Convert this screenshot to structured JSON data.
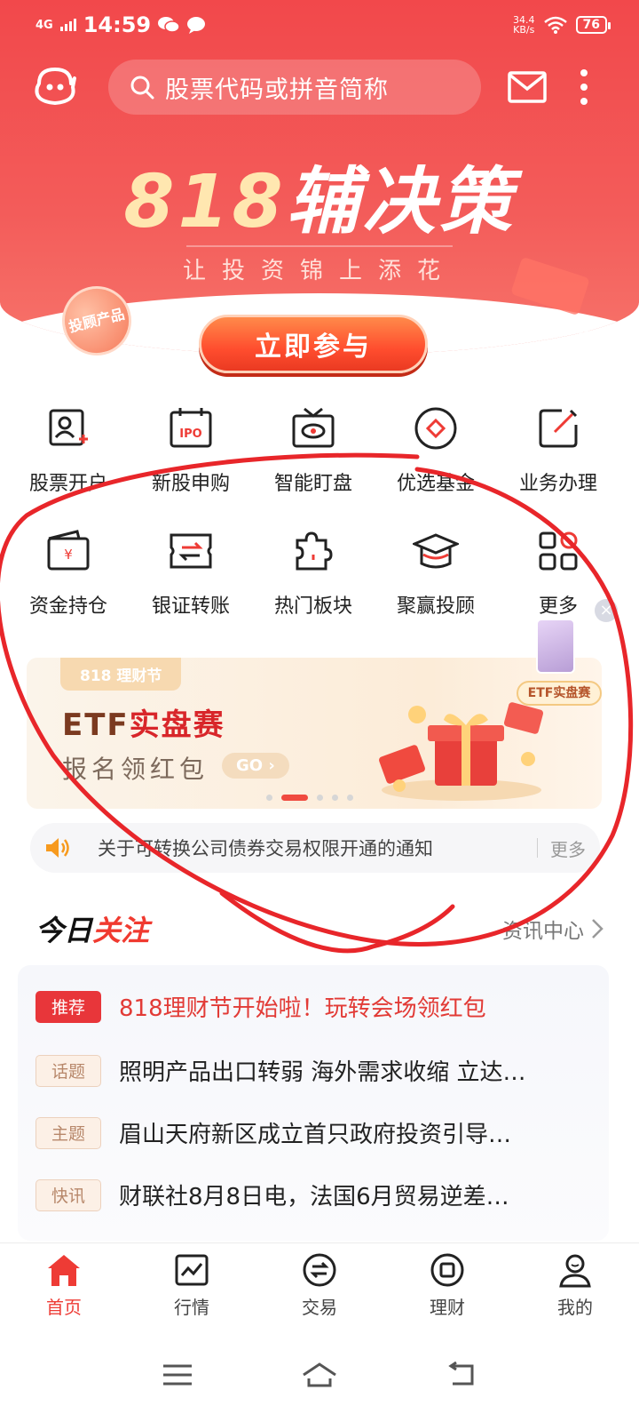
{
  "status_bar": {
    "network": "4G",
    "time": "14:59",
    "speed_value": "34.4",
    "speed_unit": "KB/s",
    "battery": "76"
  },
  "header": {
    "search_placeholder": "股票代码或拼音简称"
  },
  "hero_banner": {
    "title_num": "818",
    "title_text": "辅决策",
    "subtitle": "让投资锦上添花",
    "badge": "投顾产品",
    "cta": "立即参与",
    "close": "×"
  },
  "grid_row1": [
    {
      "label": "股票开户",
      "icon": "account-open-icon"
    },
    {
      "label": "新股申购",
      "icon": "ipo-calendar-icon"
    },
    {
      "label": "智能盯盘",
      "icon": "tv-eye-icon"
    },
    {
      "label": "优选基金",
      "icon": "fund-diamond-icon"
    },
    {
      "label": "业务办理",
      "icon": "edit-icon"
    }
  ],
  "grid_row2": [
    {
      "label": "资金持仓",
      "icon": "wallet-icon"
    },
    {
      "label": "银证转账",
      "icon": "transfer-icon"
    },
    {
      "label": "热门板块",
      "icon": "puzzle-icon"
    },
    {
      "label": "聚赢投顾",
      "icon": "graduation-cap-icon"
    },
    {
      "label": "更多",
      "icon": "grid-more-icon"
    }
  ],
  "promo": {
    "tag": "818 理财节",
    "title_prefix": "ETF",
    "title_red": "实盘赛",
    "subtitle": "报名领红包",
    "go": "GO",
    "float_label": "ETF实盘赛",
    "float_close": "×"
  },
  "notice": {
    "text": "关于可转换公司债券交易权限开通的通知",
    "more": "更多"
  },
  "today": {
    "title_black": "今日",
    "title_red": "关注",
    "info_center": "资讯中心"
  },
  "news": [
    {
      "tag": "推荐",
      "text": "818理财节开始啦！玩转会场领红包",
      "style": "rec"
    },
    {
      "tag": "话题",
      "text": "照明产品出口转弱 海外需求收缩 立达…",
      "style": "plain"
    },
    {
      "tag": "主题",
      "text": "眉山天府新区成立首只政府投资引导…",
      "style": "plain"
    },
    {
      "tag": "快讯",
      "text": "财联社8月8日电，法国6月贸易逆差…",
      "style": "plain"
    }
  ],
  "tabbar": [
    {
      "label": "首页",
      "icon": "home-icon",
      "active": true
    },
    {
      "label": "行情",
      "icon": "market-chart-icon",
      "active": false
    },
    {
      "label": "交易",
      "icon": "trade-exchange-icon",
      "active": false
    },
    {
      "label": "理财",
      "icon": "wealth-icon",
      "active": false
    },
    {
      "label": "我的",
      "icon": "profile-icon",
      "active": false
    }
  ],
  "colors": {
    "brand_red": "#f2484b",
    "accent_orange": "#ff6a3a",
    "scribble": "#e8262a"
  }
}
